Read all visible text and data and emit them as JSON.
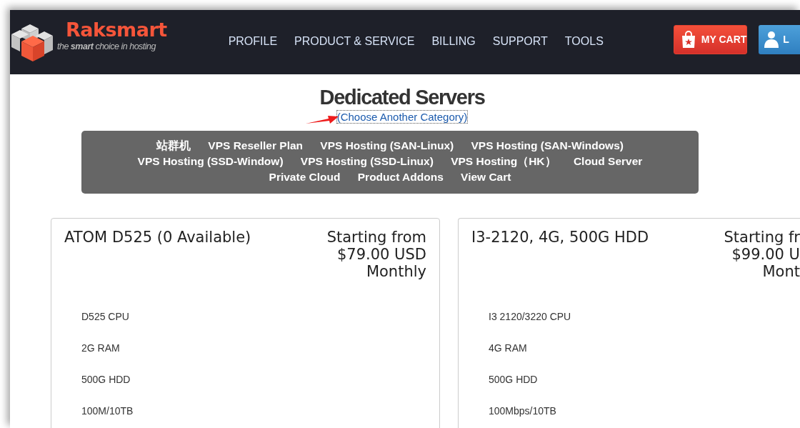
{
  "header": {
    "logo": {
      "name": "Raksmart",
      "tagline": "the **smart** choice in hosting"
    },
    "nav": [
      "PROFILE",
      "PRODUCT & SERVICE",
      "BILLING",
      "SUPPORT",
      "TOOLS"
    ],
    "cart_button": "MY CART",
    "login_button": "L"
  },
  "page": {
    "title": "Dedicated Servers",
    "category_link": "(Choose Another Category)"
  },
  "categories": [
    "站群机",
    "VPS Reseller Plan",
    "VPS Hosting (SAN-Linux)",
    "VPS Hosting (SAN-Windows)",
    "VPS Hosting (SSD-Window)",
    "VPS Hosting (SSD-Linux)",
    "VPS Hosting（HK）",
    "Cloud Server",
    "Private Cloud",
    "Product Addons",
    "View Cart"
  ],
  "products": [
    {
      "name": "ATOM D525 (0 Available)",
      "price": [
        "Starting from",
        "$79.00 USD",
        "Monthly"
      ],
      "features": [
        "D525 CPU",
        "2G RAM",
        "500G HDD",
        "100M/10TB"
      ]
    },
    {
      "name": "I3-2120, 4G, 500G HDD",
      "price": [
        "Starting fr",
        "$99.00 U",
        "Mont"
      ],
      "features": [
        "I3 2120/3220 CPU",
        "4G RAM",
        "500G HDD",
        "100Mbps/10TB"
      ]
    }
  ]
}
